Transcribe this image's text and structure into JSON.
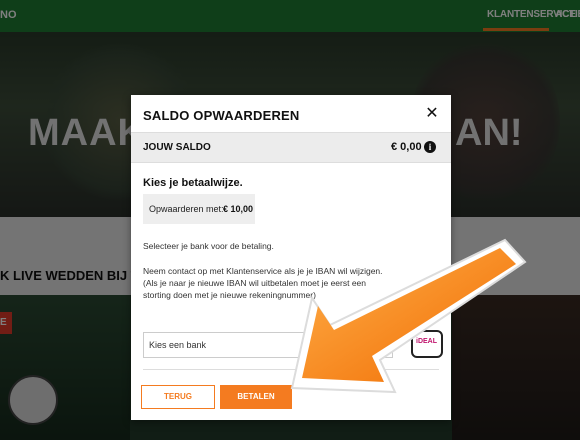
{
  "header": {
    "brand_fragment": "NO",
    "nav": [
      "KLANTENSERVICE",
      "ACTIES"
    ],
    "accent": "#f47b20",
    "bar_color": "#1e7d32"
  },
  "hero": {
    "headline_left": "MAAK",
    "headline_right": "AN!"
  },
  "stripe": {
    "text": "K LIVE WEDDEN BIJ TOT"
  },
  "lower": {
    "badge": "E"
  },
  "modal": {
    "title": "SALDO OPWAARDEREN",
    "saldo_label": "JOUW SALDO",
    "saldo_value": "€ 0,00",
    "pay_method_title": "Kies je betaalwijze.",
    "amount_label": "Opwaarderen met:",
    "amount_value": "€ 10,00",
    "bank_instruction": "Selecteer je bank voor de betaling.",
    "contact_note": "Neem contact op met Klantenservice als je je IBAN wil wijzigen. (Als je naar je nieuwe IBAN wil uitbetalen moet je eerst een storting doen met je nieuwe rekeningnummer)",
    "bank_select_placeholder": "Kies een bank",
    "ideal_label": "iDEAL",
    "back_button": "TERUG",
    "pay_button": "BETALEN"
  },
  "icons": {
    "close": "close-icon",
    "info": "info-icon",
    "arrow": "pointer-arrow-icon"
  }
}
